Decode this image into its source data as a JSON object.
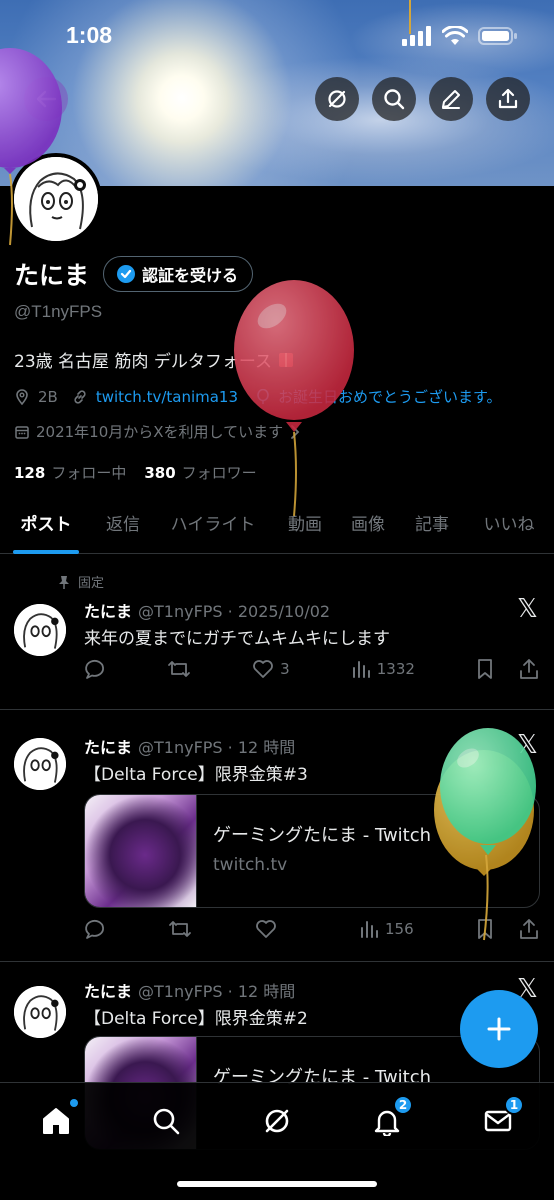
{
  "status_bar": {
    "time": "1:08"
  },
  "profile": {
    "display_name": "たにま",
    "verify_label": "認証を受ける",
    "handle": "@T1nyFPS",
    "bio": "23歳 名古屋 筋肉 デルタフォース",
    "location": "2B",
    "link": "twitch.tv/tanima13",
    "birthday_text": "お誕生日おめでとうございます。",
    "joined": "2021年10月からXを利用しています",
    "following_count": "128",
    "following_label": "フォロー中",
    "followers_count": "380",
    "followers_label": "フォロワー"
  },
  "tabs": [
    {
      "label": "ポスト"
    },
    {
      "label": "返信"
    },
    {
      "label": "ハイライト"
    },
    {
      "label": "動画"
    },
    {
      "label": "画像"
    },
    {
      "label": "記事"
    },
    {
      "label": "いいね"
    }
  ],
  "posts": [
    {
      "pinned_label": "固定",
      "name": "たにま",
      "handle_time": "@T1nyFPS · 2025/10/02",
      "text": "来年の夏までにガチでムキムキにします",
      "likes": "3",
      "views": "1332"
    },
    {
      "name": "たにま",
      "handle_time": "@T1nyFPS · 12 時間",
      "text": "【Delta Force】限界金策#3",
      "card_title": "ゲーミングたにま - Twitch",
      "card_domain": "twitch.tv",
      "views": "156"
    },
    {
      "name": "たにま",
      "handle_time": "@T1nyFPS · 12 時間",
      "text": "【Delta Force】限界金策#2",
      "card_title": "ゲーミングたにま - Twitch"
    }
  ],
  "nav": {
    "notifications_badge": "2",
    "messages_badge": "1"
  },
  "colors": {
    "accent": "#1d9bf0",
    "background": "#000000",
    "muted_text": "#71767b"
  }
}
